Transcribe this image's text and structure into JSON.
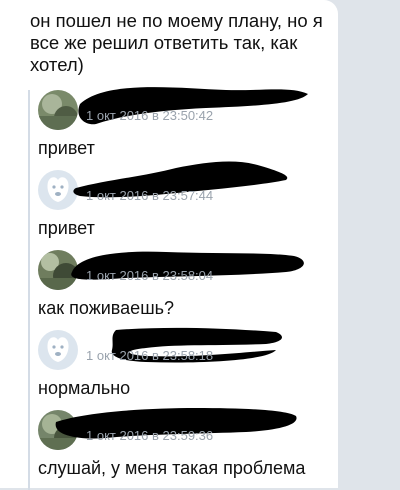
{
  "message": {
    "text": "он пошел не по моему плану, но я все же решил ответить так, как хотел)"
  },
  "forwarded": [
    {
      "avatar": "photo",
      "timestamp": "1 окт 2016 в 23:50:42",
      "text": "привет"
    },
    {
      "avatar": "default-dog",
      "timestamp": "1 окт 2016 в 23:57:44",
      "text": "привет"
    },
    {
      "avatar": "photo",
      "timestamp": "1 окт 2016 в 23:58:04",
      "text": "как поживаешь?"
    },
    {
      "avatar": "default-dog",
      "timestamp": "1 окт 2016 в 23:58:18",
      "text": "нормально"
    },
    {
      "avatar": "photo",
      "timestamp": "1 окт 2016 в 23:59:36",
      "text": "слушай, у меня такая проблема"
    }
  ],
  "colors": {
    "background": "#dfe4ea",
    "bubble": "#ffffff",
    "timestamp": "#9aa3ad",
    "redaction": "#000000",
    "quote_line": "#d4dce6"
  }
}
